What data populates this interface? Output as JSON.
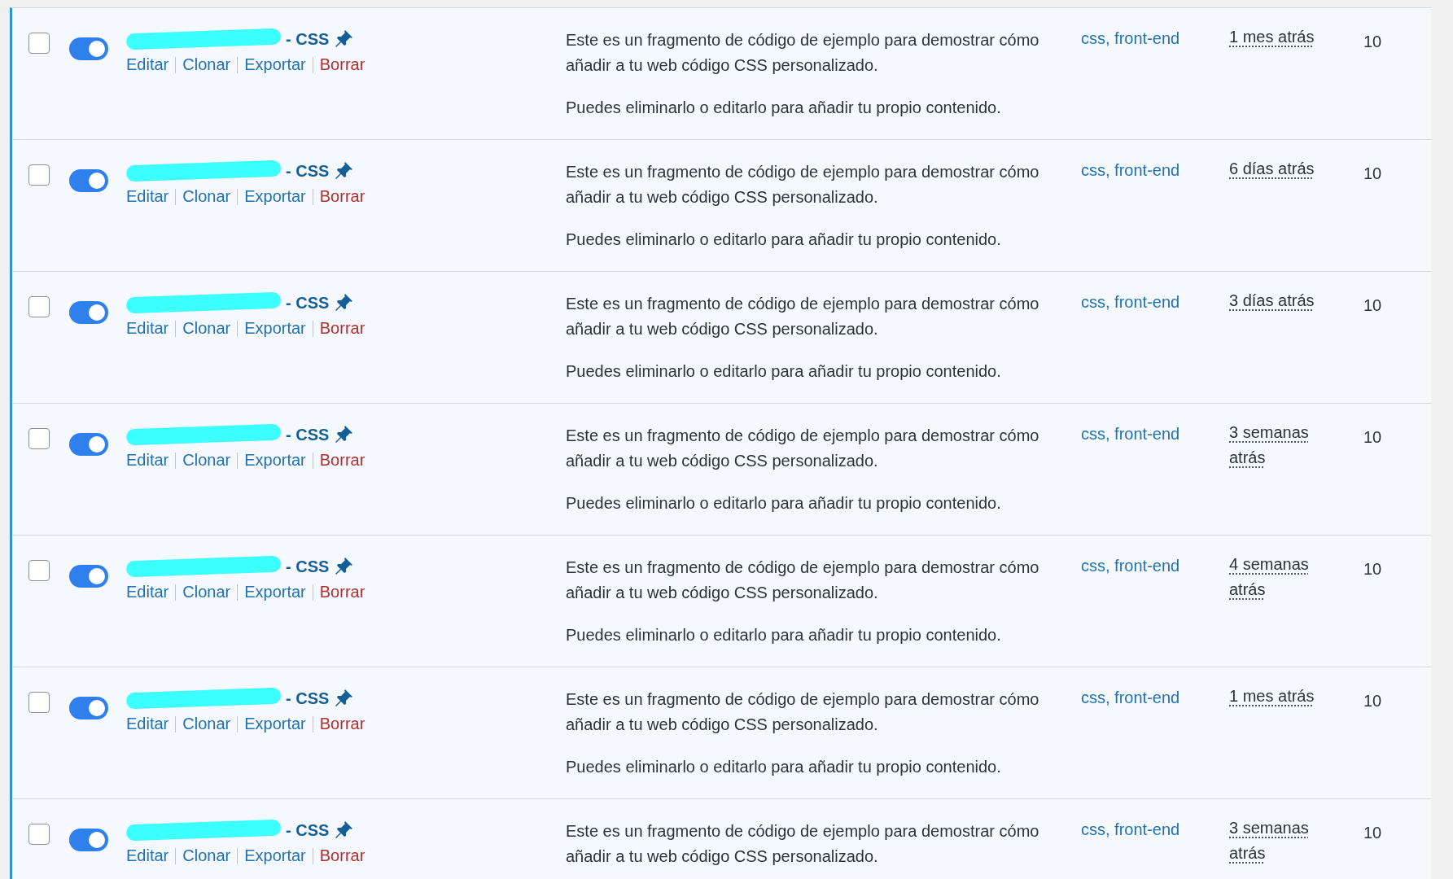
{
  "rows": [
    {
      "checked": false,
      "active": true,
      "title": "- CSS",
      "redacted": true,
      "actions": [
        {
          "label": "Editar",
          "kind": "normal"
        },
        {
          "label": "Clonar",
          "kind": "normal"
        },
        {
          "label": "Exportar",
          "kind": "normal"
        },
        {
          "label": "Borrar",
          "kind": "danger"
        }
      ],
      "description": [
        "Este es un fragmento de código de ejemplo para demostrar cómo añadir a tu web código CSS personalizado.",
        "Puedes eliminarlo o editarlo para añadir tu propio contenido."
      ],
      "tags": "css, front-end",
      "modified": "1 mes atrás",
      "priority": "10"
    },
    {
      "checked": false,
      "active": true,
      "title": "- CSS",
      "redacted": true,
      "actions": [
        {
          "label": "Editar",
          "kind": "normal"
        },
        {
          "label": "Clonar",
          "kind": "normal"
        },
        {
          "label": "Exportar",
          "kind": "normal"
        },
        {
          "label": "Borrar",
          "kind": "danger"
        }
      ],
      "description": [
        "Este es un fragmento de código de ejemplo para demostrar cómo añadir a tu web código CSS personalizado.",
        "Puedes eliminarlo o editarlo para añadir tu propio contenido."
      ],
      "tags": "css, front-end",
      "modified": "6 días atrás",
      "priority": "10"
    },
    {
      "checked": false,
      "active": true,
      "title": "- CSS",
      "redacted": true,
      "actions": [
        {
          "label": "Editar",
          "kind": "normal"
        },
        {
          "label": "Clonar",
          "kind": "normal"
        },
        {
          "label": "Exportar",
          "kind": "normal"
        },
        {
          "label": "Borrar",
          "kind": "danger"
        }
      ],
      "description": [
        "Este es un fragmento de código de ejemplo para demostrar cómo añadir a tu web código CSS personalizado.",
        "Puedes eliminarlo o editarlo para añadir tu propio contenido."
      ],
      "tags": "css, front-end",
      "modified": "3 días atrás",
      "priority": "10"
    },
    {
      "checked": false,
      "active": true,
      "title": "- CSS",
      "redacted": true,
      "actions": [
        {
          "label": "Editar",
          "kind": "normal"
        },
        {
          "label": "Clonar",
          "kind": "normal"
        },
        {
          "label": "Exportar",
          "kind": "normal"
        },
        {
          "label": "Borrar",
          "kind": "danger"
        }
      ],
      "description": [
        "Este es un fragmento de código de ejemplo para demostrar cómo añadir a tu web código CSS personalizado.",
        "Puedes eliminarlo o editarlo para añadir tu propio contenido."
      ],
      "tags": "css, front-end",
      "modified": "3 semanas atrás",
      "priority": "10"
    },
    {
      "checked": false,
      "active": true,
      "title": "- CSS",
      "redacted": true,
      "actions": [
        {
          "label": "Editar",
          "kind": "normal"
        },
        {
          "label": "Clonar",
          "kind": "normal"
        },
        {
          "label": "Exportar",
          "kind": "normal"
        },
        {
          "label": "Borrar",
          "kind": "danger"
        }
      ],
      "description": [
        "Este es un fragmento de código de ejemplo para demostrar cómo añadir a tu web código CSS personalizado.",
        "Puedes eliminarlo o editarlo para añadir tu propio contenido."
      ],
      "tags": "css, front-end",
      "modified": "4 semanas atrás",
      "priority": "10"
    },
    {
      "checked": false,
      "active": true,
      "title": "- CSS",
      "redacted": true,
      "actions": [
        {
          "label": "Editar",
          "kind": "normal"
        },
        {
          "label": "Clonar",
          "kind": "normal"
        },
        {
          "label": "Exportar",
          "kind": "normal"
        },
        {
          "label": "Borrar",
          "kind": "danger"
        }
      ],
      "description": [
        "Este es un fragmento de código de ejemplo para demostrar cómo añadir a tu web código CSS personalizado.",
        "Puedes eliminarlo o editarlo para añadir tu propio contenido."
      ],
      "tags": "css, front-end",
      "modified": "1 mes atrás",
      "priority": "10"
    },
    {
      "checked": false,
      "active": true,
      "title": "- CSS",
      "redacted": true,
      "actions": [
        {
          "label": "Editar",
          "kind": "normal"
        },
        {
          "label": "Clonar",
          "kind": "normal"
        },
        {
          "label": "Exportar",
          "kind": "normal"
        },
        {
          "label": "Borrar",
          "kind": "danger"
        }
      ],
      "description": [
        "Este es un fragmento de código de ejemplo para demostrar cómo añadir a tu web código CSS personalizado."
      ],
      "tags": "css, front-end",
      "modified": "3 semanas atrás",
      "priority": "10"
    }
  ]
}
